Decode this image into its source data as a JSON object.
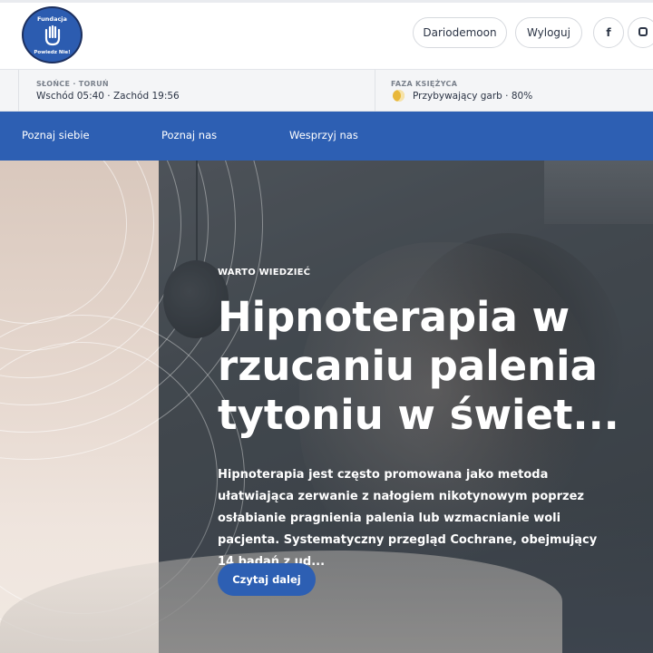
{
  "header": {
    "logo": {
      "top_text": "Fundacja",
      "bottom_text": "Powiedz Nie!"
    },
    "user_label": "Dariodemoon",
    "logout_label": "Wyloguj",
    "social": {
      "facebook_glyph": "f",
      "facebook_icon": "facebook-icon",
      "instagram_icon": "instagram-icon"
    }
  },
  "info": {
    "sun": {
      "label": "SŁOŃCE · TORUŃ",
      "value": "Wschód 05:40 · Zachód 19:56"
    },
    "moon": {
      "label": "FAZA KSIĘŻYCA",
      "icon": "moon-phase-icon",
      "value": "Przybywający garb · 80%"
    }
  },
  "nav": {
    "items": [
      {
        "label": "Poznaj siebie"
      },
      {
        "label": "Poznaj nas"
      },
      {
        "label": "Wesprzyj nas"
      }
    ]
  },
  "hero": {
    "kicker": "WARTO WIEDZIEĆ",
    "title": "Hipnoterapia w rzucaniu palenia tytoniu w świet...",
    "excerpt": "Hipnoterapia jest często promowana jako metoda ułatwiająca zerwanie z nałogiem nikotynowym poprzez osłabianie pragnienia palenia lub wzmacnianie woli pacjenta. Systematyczny przegląd Cochrane, obejmujący 14 badań z ud...",
    "button_label": "Czytaj dalej"
  },
  "colors": {
    "brand_blue": "#2d5fb3",
    "text_dark": "#2b3445"
  }
}
